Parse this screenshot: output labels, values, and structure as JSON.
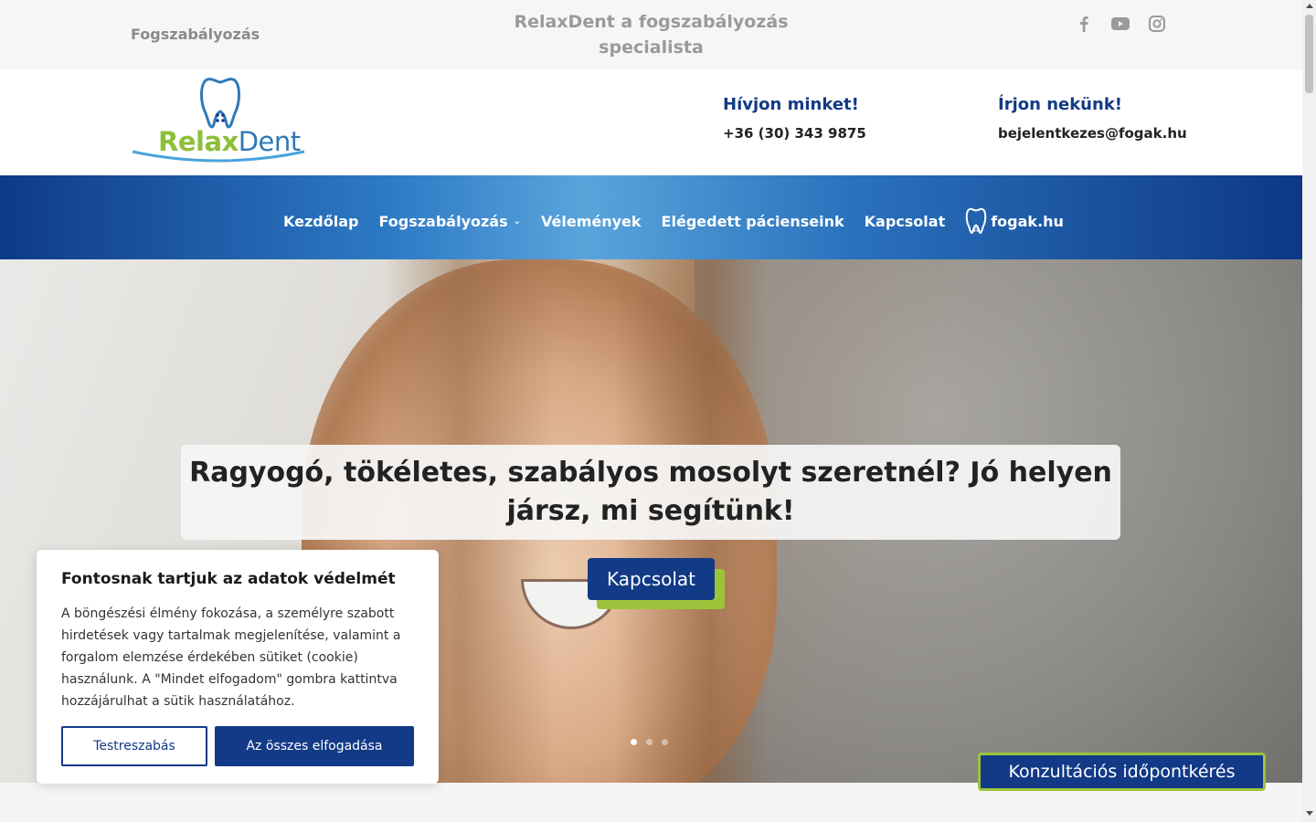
{
  "topbar": {
    "left_link": "Fogszabályozás",
    "tagline": "RelaxDent a fogszabályozás specialista",
    "socials": [
      "facebook-icon",
      "youtube-icon",
      "instagram-icon"
    ]
  },
  "logo": {
    "word_relax": "Relax",
    "word_dent": "Dent"
  },
  "contact": {
    "phone_title": "Hívjon minket!",
    "phone_value": "+36 (30) 343 9875",
    "mail_title": "Írjon nekünk!",
    "mail_value": "bejelentkezes@fogak.hu"
  },
  "nav": {
    "items": [
      "Kezdőlap",
      "Fogszabályozás",
      "Vélemények",
      "Elégedett pácienseink",
      "Kapcsolat",
      "fogak.hu"
    ]
  },
  "hero": {
    "caption": "Ragyogó, tökéletes, szabályos mosolyt szeretnél? Jó helyen jársz, mi segítünk!",
    "button": "Kapcsolat",
    "slide_count": 3,
    "active_slide": 1
  },
  "cookie": {
    "title": "Fontosnak tartjuk az adatok védelmét",
    "text": "A böngészési élmény fokozása, a személyre szabott hirdetések vagy tartalmak megjelenítése, valamint a forgalom elemzése érdekében sütiket (cookie) használunk. A \"Mindet elfogadom\" gombra kattintva hozzájárulhat a sütik használatához.",
    "customize": "Testreszabás",
    "accept": "Az összes elfogadása"
  },
  "consult_button": "Konzultációs időpontkérés",
  "colors": {
    "brand_blue": "#123a86",
    "brand_green": "#9cc43a"
  }
}
